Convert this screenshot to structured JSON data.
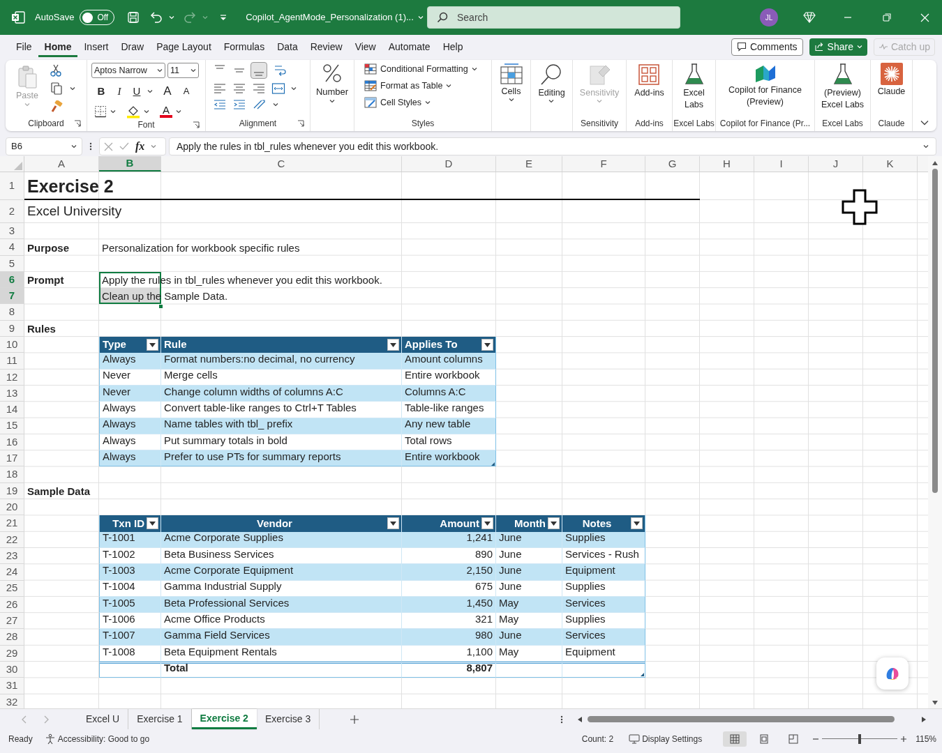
{
  "title_bar": {
    "autosave_label": "AutoSave",
    "autosave_on": false,
    "autosave_state": "Off",
    "file_name": "Copilot_AgentMode_Personalization (1)...",
    "search_placeholder": "Search",
    "avatar": "JL"
  },
  "menu_tabs": [
    {
      "label": "File",
      "selected": false
    },
    {
      "label": "Home",
      "selected": true
    },
    {
      "label": "Insert",
      "selected": false
    },
    {
      "label": "Draw",
      "selected": false
    },
    {
      "label": "Page Layout",
      "selected": false
    },
    {
      "label": "Formulas",
      "selected": false
    },
    {
      "label": "Data",
      "selected": false
    },
    {
      "label": "Review",
      "selected": false
    },
    {
      "label": "View",
      "selected": false
    },
    {
      "label": "Automate",
      "selected": false
    },
    {
      "label": "Help",
      "selected": false
    }
  ],
  "header_buttons": {
    "comments": "Comments",
    "share": "Share",
    "catch_up": "Catch up"
  },
  "ribbon": {
    "clipboard": {
      "paste": "Paste",
      "paste_disabled": true,
      "label": "Clipboard"
    },
    "font": {
      "name": "Aptos Narrow",
      "size": "11",
      "label": "Font",
      "bold": "B",
      "italic": "I",
      "underline": "U",
      "grow_glyph": "A",
      "shrink_glyph": "A",
      "font_colour_glyph": "A"
    },
    "alignment": {
      "label": "Alignment",
      "vertical": [
        {
          "kind": "top",
          "selected": false
        },
        {
          "kind": "middle",
          "selected": false
        },
        {
          "kind": "bottom",
          "selected": true
        }
      ]
    },
    "number": {
      "label": "Number"
    },
    "styles": {
      "label": "Styles",
      "items": [
        {
          "kind": "conditional",
          "label": "Conditional Formatting"
        },
        {
          "kind": "table",
          "label": "Format as Table"
        },
        {
          "kind": "cellstyles",
          "label": "Cell Styles"
        }
      ]
    },
    "commands": [
      {
        "kind": "cells",
        "label": "Cells",
        "dropdown": true,
        "disabled": false
      },
      {
        "kind": "editing",
        "label": "Editing",
        "dropdown": true,
        "disabled": false
      },
      {
        "kind": "sensitivity",
        "label": "Sensitivity",
        "group": "Sensitivity",
        "dropdown": true,
        "disabled": true
      },
      {
        "kind": "addins",
        "label": "Add-ins",
        "group": "Add-ins",
        "dropdown": false,
        "disabled": false
      },
      {
        "kind": "flask",
        "label": "Excel Labs",
        "group": "Excel Labs",
        "dropdown": false,
        "disabled": false
      },
      {
        "kind": "copilot",
        "label": "Copilot for Finance (Preview)",
        "group": "Copilot for Finance (Pr...",
        "dropdown": false,
        "disabled": false
      },
      {
        "kind": "flask",
        "label": "(Preview) Excel Labs",
        "group": "Excel Labs",
        "dropdown": false,
        "disabled": false
      },
      {
        "kind": "claude",
        "label": "Claude",
        "group": "Claude",
        "dropdown": false,
        "disabled": false
      }
    ]
  },
  "formula_bar": {
    "name_box": "B6",
    "fx": "fx",
    "value": "Apply the rules in tbl_rules whenever you edit this workbook."
  },
  "sheet": {
    "columns": [
      {
        "label": "A",
        "selected": false
      },
      {
        "label": "B",
        "selected": true
      },
      {
        "label": "C",
        "selected": false
      },
      {
        "label": "D",
        "selected": false
      },
      {
        "label": "E",
        "selected": false
      },
      {
        "label": "F",
        "selected": false
      },
      {
        "label": "G",
        "selected": false
      },
      {
        "label": "H",
        "selected": false
      },
      {
        "label": "I",
        "selected": false
      },
      {
        "label": "J",
        "selected": false
      },
      {
        "label": "K",
        "selected": false
      }
    ],
    "rows": [
      {
        "number": "1",
        "selected": false,
        "cells": {
          "A": {
            "text": "Exercise 2",
            "selected": false
          }
        }
      },
      {
        "number": "2",
        "selected": false,
        "cells": {
          "A": {
            "text": "Excel University",
            "selected": false
          }
        }
      },
      {
        "number": "3",
        "selected": false
      },
      {
        "number": "4",
        "selected": false,
        "cells": {
          "A": {
            "text": "Purpose",
            "selected": false
          },
          "B": {
            "text": "Personalization for workbook specific rules",
            "selected": false
          }
        }
      },
      {
        "number": "5",
        "selected": false
      },
      {
        "number": "6",
        "selected": true,
        "cells": {
          "A": {
            "text": "Prompt",
            "selected": false
          },
          "B": {
            "text": "Apply the rules in tbl_rules whenever you edit this workbook.",
            "selected": true
          }
        }
      },
      {
        "number": "7",
        "selected": true,
        "cells": {
          "B": {
            "text": "Clean up the Sample Data.",
            "selected": true
          }
        }
      },
      {
        "number": "8",
        "selected": false
      },
      {
        "number": "9",
        "selected": false,
        "cells": {
          "A": {
            "text": "Rules",
            "selected": false
          }
        }
      },
      {
        "number": "10",
        "selected": false
      },
      {
        "number": "11",
        "selected": false
      },
      {
        "number": "12",
        "selected": false
      },
      {
        "number": "13",
        "selected": false
      },
      {
        "number": "14",
        "selected": false
      },
      {
        "number": "15",
        "selected": false
      },
      {
        "number": "16",
        "selected": false
      },
      {
        "number": "17",
        "selected": false
      },
      {
        "number": "18",
        "selected": false
      },
      {
        "number": "19",
        "selected": false,
        "cells": {
          "A": {
            "text": "Sample Data",
            "selected": false
          }
        }
      },
      {
        "number": "20",
        "selected": false
      },
      {
        "number": "21",
        "selected": false
      },
      {
        "number": "22",
        "selected": false
      },
      {
        "number": "23",
        "selected": false
      },
      {
        "number": "24",
        "selected": false
      },
      {
        "number": "25",
        "selected": false
      },
      {
        "number": "26",
        "selected": false
      },
      {
        "number": "27",
        "selected": false
      },
      {
        "number": "28",
        "selected": false
      },
      {
        "number": "29",
        "selected": false
      },
      {
        "number": "30",
        "selected": false
      },
      {
        "number": "31",
        "selected": false
      },
      {
        "number": "32",
        "selected": false
      }
    ],
    "tables": [
      {
        "columns": [
          "Type",
          "Rule",
          "Applies To"
        ],
        "rows": [
          [
            "Always",
            "Format numbers:no decimal, no currency",
            "Amount columns"
          ],
          [
            "Never",
            "Merge cells",
            "Entire workbook"
          ],
          [
            "Never",
            "Change column widths of columns A:C",
            "Columns A:C"
          ],
          [
            "Always",
            "Convert table-like ranges to Ctrl+T Tables",
            "Table-like ranges"
          ],
          [
            "Always",
            "Name tables with tbl_ prefix",
            "Any new table"
          ],
          [
            "Always",
            "Put summary totals in bold",
            "Total rows"
          ],
          [
            "Always",
            "Prefer to use PTs for summary reports",
            "Entire workbook"
          ]
        ]
      },
      {
        "columns": [
          "Txn ID",
          "Vendor",
          "Amount",
          "Month",
          "Notes"
        ],
        "rows": [
          [
            "T-1001",
            "Acme Corporate Supplies",
            "1,241",
            "June",
            "Supplies"
          ],
          [
            "T-1002",
            "Beta Business Services",
            "890",
            "June",
            "Services - Rush"
          ],
          [
            "T-1003",
            "Acme Corporate Equipment",
            "2,150",
            "June",
            "Equipment"
          ],
          [
            "T-1004",
            "Gamma Industrial Supply",
            "675",
            "June",
            "Supplies"
          ],
          [
            "T-1005",
            "Beta Professional Services",
            "1,450",
            "May",
            "Services"
          ],
          [
            "T-1006",
            "Acme Office Products",
            "321",
            "May",
            "Supplies"
          ],
          [
            "T-1007",
            "Gamma Field Services",
            "980",
            "June",
            "Services"
          ],
          [
            "T-1008",
            "Beta Equipment Rentals",
            "1,100",
            "May",
            "Equipment"
          ]
        ],
        "total_row": {
          "label": "Total",
          "amount": "8,807"
        }
      }
    ]
  },
  "sheet_tabs": [
    {
      "label": "Excel U",
      "selected": false
    },
    {
      "label": "Exercise 1",
      "selected": false
    },
    {
      "label": "Exercise 2",
      "selected": true
    },
    {
      "label": "Exercise 3",
      "selected": false
    }
  ],
  "status_bar": {
    "ready": "Ready",
    "accessibility": "Accessibility: Good to go",
    "count": "Count: 2",
    "display_settings": "Display Settings",
    "views": [
      {
        "kind": "normal",
        "selected": true
      },
      {
        "kind": "page_layout",
        "selected": false
      },
      {
        "kind": "page_break",
        "selected": false
      }
    ],
    "zoom": {
      "level": 0.5,
      "label": "115%"
    }
  }
}
